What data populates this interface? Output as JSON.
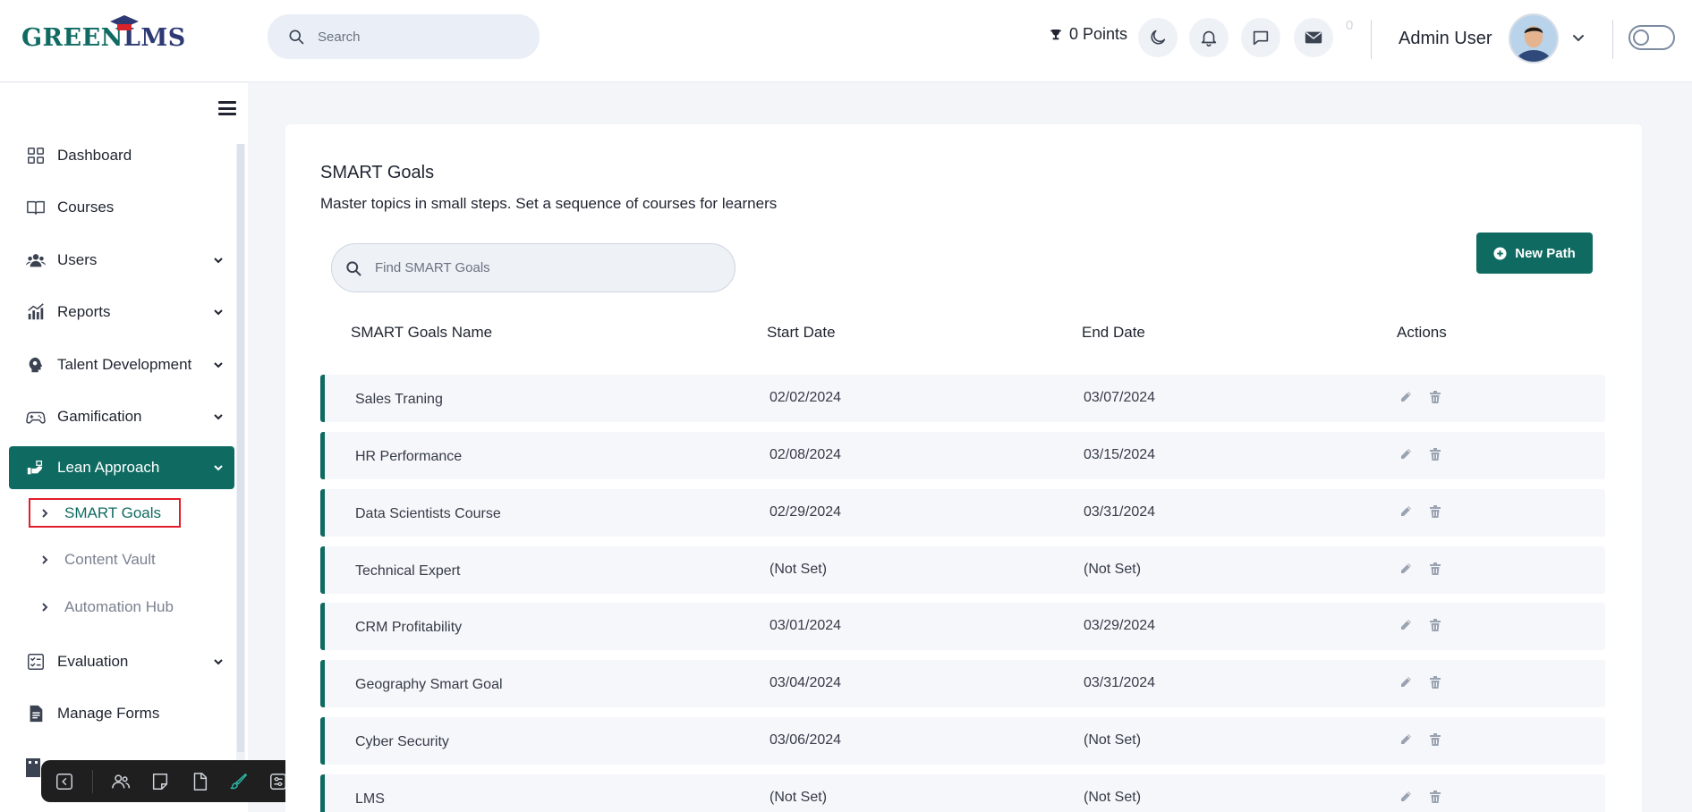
{
  "header": {
    "logo_text_1": "GREEN ",
    "logo_text_2": "LMS",
    "search_placeholder": "Search",
    "points": "0 Points",
    "message_count": "0",
    "user_name": "Admin User"
  },
  "sidebar": {
    "items": [
      {
        "label": "Dashboard",
        "icon": "dashboard-icon"
      },
      {
        "label": "Courses",
        "icon": "book-icon"
      },
      {
        "label": "Users",
        "icon": "users-icon"
      },
      {
        "label": "Reports",
        "icon": "chart-icon"
      },
      {
        "label": "Talent Development",
        "icon": "talent-icon"
      },
      {
        "label": "Gamification",
        "icon": "gamepad-icon"
      },
      {
        "label": "Lean Approach",
        "icon": "lean-icon"
      },
      {
        "label": "Evaluation",
        "icon": "evaluation-icon"
      },
      {
        "label": "Manage Forms",
        "icon": "form-icon"
      }
    ],
    "sub_items": [
      {
        "label": "SMART Goals"
      },
      {
        "label": "Content Vault"
      },
      {
        "label": "Automation Hub"
      }
    ]
  },
  "main": {
    "title": "SMART Goals",
    "subtitle": "Master topics in small steps. Set a sequence of courses for learners",
    "find_placeholder": "Find SMART Goals",
    "new_button": "New Path",
    "columns": [
      "SMART Goals Name",
      "Start Date",
      "End Date",
      "Actions"
    ],
    "rows": [
      {
        "name": "Sales Traning",
        "start": "02/02/2024",
        "end": "03/07/2024"
      },
      {
        "name": "HR Performance",
        "start": "02/08/2024",
        "end": "03/15/2024"
      },
      {
        "name": "Data Scientists Course",
        "start": "02/29/2024",
        "end": "03/31/2024"
      },
      {
        "name": "Technical Expert",
        "start": "(Not Set)",
        "end": "(Not Set)"
      },
      {
        "name": "CRM Profitability",
        "start": "03/01/2024",
        "end": "03/29/2024"
      },
      {
        "name": "Geography Smart Goal",
        "start": "03/04/2024",
        "end": "03/31/2024"
      },
      {
        "name": "Cyber Security",
        "start": "03/06/2024",
        "end": "(Not Set)"
      },
      {
        "name": "LMS",
        "start": "(Not Set)",
        "end": "(Not Set)"
      }
    ]
  },
  "colors": {
    "brand": "#0f6b62",
    "highlight": "#e11d2a",
    "toolbar": "#1f1f1f"
  }
}
